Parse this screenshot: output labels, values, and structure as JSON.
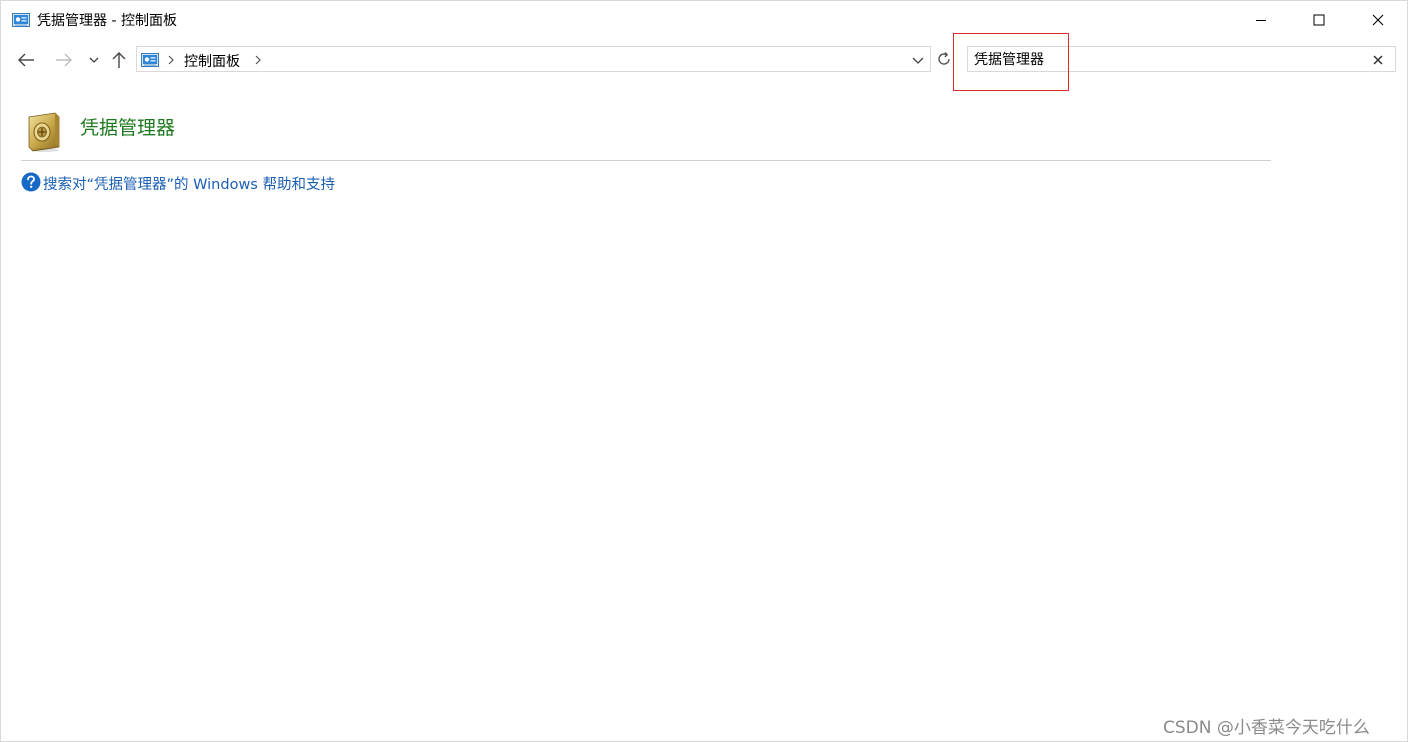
{
  "window": {
    "title": "凭据管理器 - 控制面板"
  },
  "address_bar": {
    "crumb": "控制面板"
  },
  "search": {
    "value": "凭据管理器"
  },
  "result": {
    "title": "凭据管理器",
    "help_link": "搜索对“凭据管理器”的 Windows 帮助和支持"
  },
  "watermark": "CSDN @小香菜今天吃什么",
  "icons": {
    "title": "control-panel-icon",
    "result": "credential-vault-icon",
    "help": "help-question-icon"
  },
  "colors": {
    "result_title": "#1e7a1e",
    "link": "#1a5fb4",
    "highlight": "#e0282e"
  }
}
